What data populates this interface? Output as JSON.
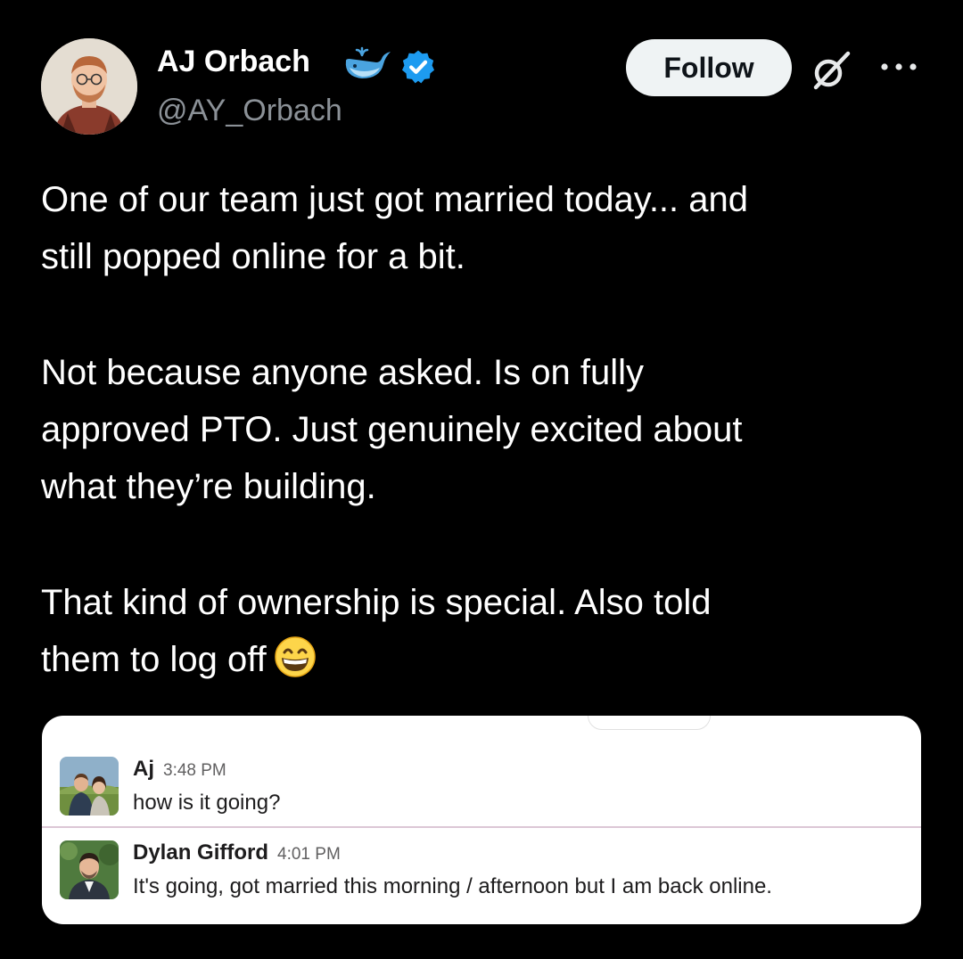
{
  "author": {
    "display_name": "AJ Orbach",
    "handle": "@AY_Orbach",
    "badges": [
      "whale-icon",
      "verified-icon"
    ]
  },
  "header": {
    "follow_label": "Follow",
    "icons": [
      "grok-icon",
      "more-icon"
    ]
  },
  "tweet": {
    "paragraphs": [
      "One of our team just got married today... and\nstill popped online for a bit.",
      "Not because anyone asked. Is on fully\napproved PTO. Just genuinely excited about\nwhat they’re building.",
      "That kind of ownership is special. Also told\nthem to log off"
    ],
    "trailing_emoji": "grinning-face-icon"
  },
  "media": {
    "messages": [
      {
        "name": "Aj",
        "time": "3:48 PM",
        "text": "how is it going?"
      },
      {
        "name": "Dylan Gifford",
        "time": "4:01 PM",
        "text": "It's going, got married this morning / afternoon but I am back online."
      }
    ]
  },
  "colors": {
    "background": "#000000",
    "text_primary": "#ffffff",
    "text_secondary": "#8b9197",
    "verified": "#1d9bf0",
    "follow_bg": "#eff3f4"
  }
}
